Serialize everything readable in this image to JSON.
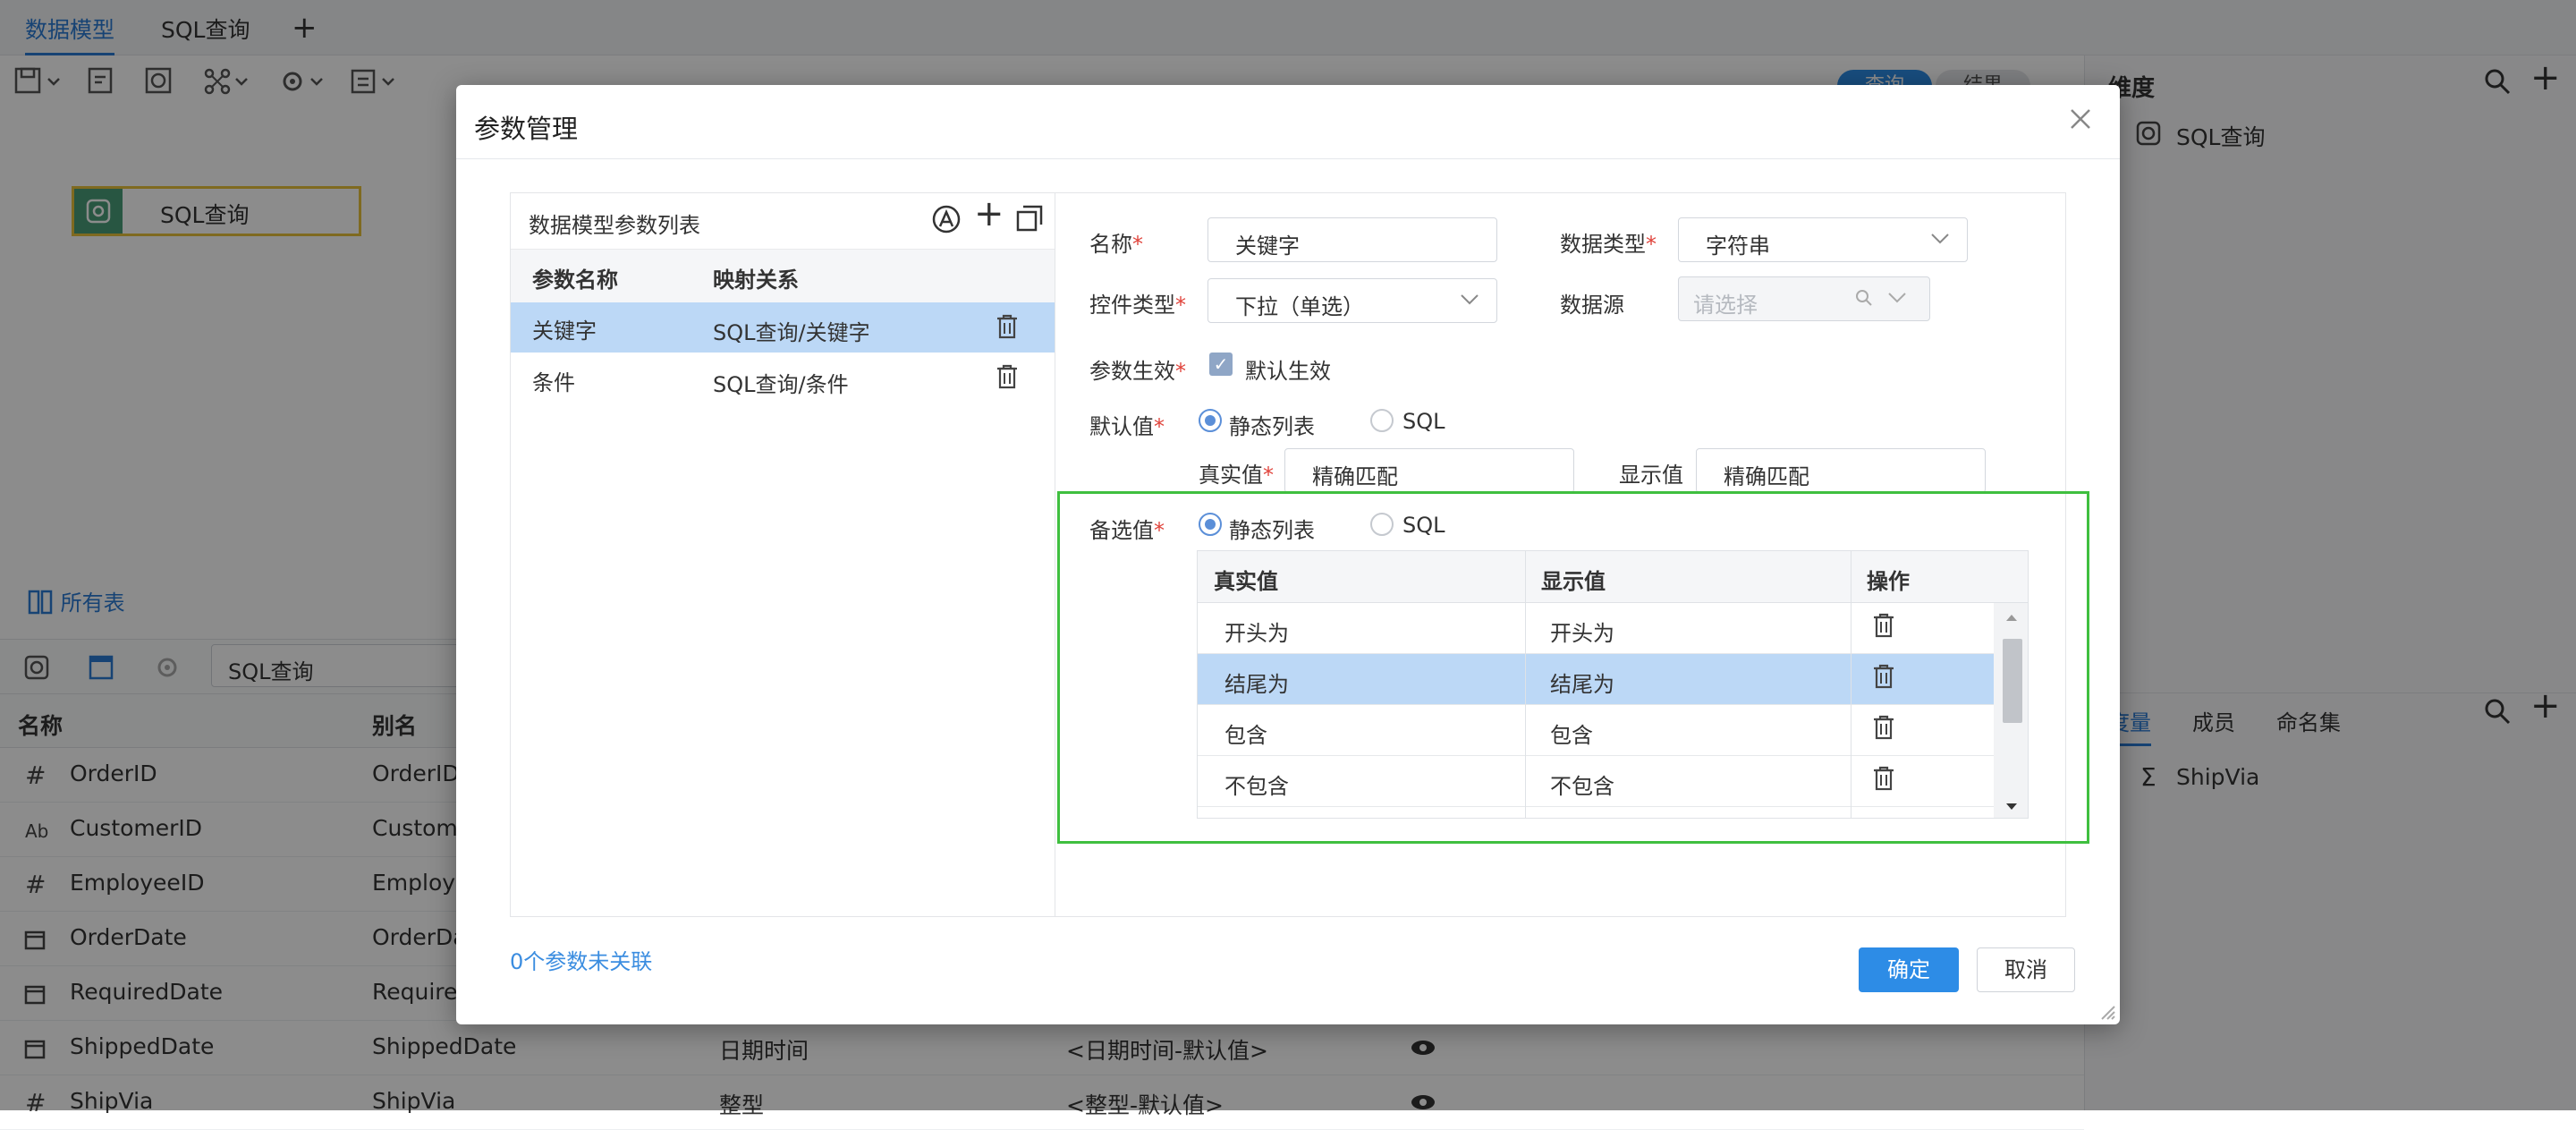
{
  "tabs": {
    "data_model": "数据模型",
    "sql_query": "SQL查询",
    "add": "+"
  },
  "canvas": {
    "node_label": "SQL查询",
    "all_tables": "所有表"
  },
  "lower": {
    "search_value": "SQL查询",
    "col_name": "名称",
    "col_alias": "别名",
    "rows": [
      {
        "icon": "#",
        "name": "OrderID",
        "alias": "OrderID",
        "type": "",
        "default": ""
      },
      {
        "icon": "Ab",
        "name": "CustomerID",
        "alias": "Custome",
        "type": "",
        "default": ""
      },
      {
        "icon": "#",
        "name": "EmployeeID",
        "alias": "Employe",
        "type": "",
        "default": ""
      },
      {
        "icon": "cal",
        "name": "OrderDate",
        "alias": "OrderDa",
        "type": "",
        "default": ""
      },
      {
        "icon": "cal",
        "name": "RequiredDate",
        "alias": "Require",
        "type": "",
        "default": ""
      },
      {
        "icon": "cal",
        "name": "ShippedDate",
        "alias": "ShippedDate",
        "type": "日期时间",
        "default": "<日期时间-默认值>"
      },
      {
        "icon": "#",
        "name": "ShipVia",
        "alias": "ShipVia",
        "type": "整型",
        "default": "<整型-默认值>"
      }
    ]
  },
  "right_panel": {
    "dimension_title": "维度",
    "dimension_item": "SQL查询",
    "tabs": [
      "度量",
      "成员",
      "命名集"
    ],
    "measure_item": "ShipVia",
    "toolbar_btn1": "查询",
    "toolbar_btn2": "结果"
  },
  "dialog": {
    "title": "参数管理",
    "list_title": "数据模型参数列表",
    "list_col_name": "参数名称",
    "list_col_mapping": "映射关系",
    "params": [
      {
        "name": "关键字",
        "mapping": "SQL查询/关键字",
        "selected": true
      },
      {
        "name": "条件",
        "mapping": "SQL查询/条件",
        "selected": false
      }
    ],
    "unlinked": "0个参数未关联",
    "form": {
      "name_label": "名称",
      "name_value": "关键字",
      "data_type_label": "数据类型",
      "data_type_value": "字符串",
      "control_type_label": "控件类型",
      "control_type_value": "下拉（单选）",
      "datasource_label": "数据源",
      "datasource_placeholder": "请选择",
      "effective_label": "参数生效",
      "effective_check": "默认生效",
      "default_label": "默认值",
      "radio_static": "静态列表",
      "radio_sql": "SQL",
      "real_value_label": "真实值",
      "real_value": "精确匹配",
      "display_value_label": "显示值",
      "display_value": "精确匹配",
      "options_label": "备选值",
      "options_radio_static": "静态列表",
      "options_radio_sql": "SQL"
    },
    "options_table": {
      "col_real": "真实值",
      "col_display": "显示值",
      "col_action": "操作",
      "rows": [
        {
          "real": "开头为",
          "display": "开头为",
          "selected": false
        },
        {
          "real": "结尾为",
          "display": "结尾为",
          "selected": true
        },
        {
          "real": "包含",
          "display": "包含",
          "selected": false
        },
        {
          "real": "不包含",
          "display": "不包含",
          "selected": false
        }
      ]
    },
    "ok": "确定",
    "cancel": "取消"
  },
  "colors": {
    "accent": "#2d8ce6",
    "selected_row": "#bcd8f6",
    "highlight_box": "#3fbf3f",
    "node_border": "#e8c13b",
    "required": "#e0433b"
  }
}
